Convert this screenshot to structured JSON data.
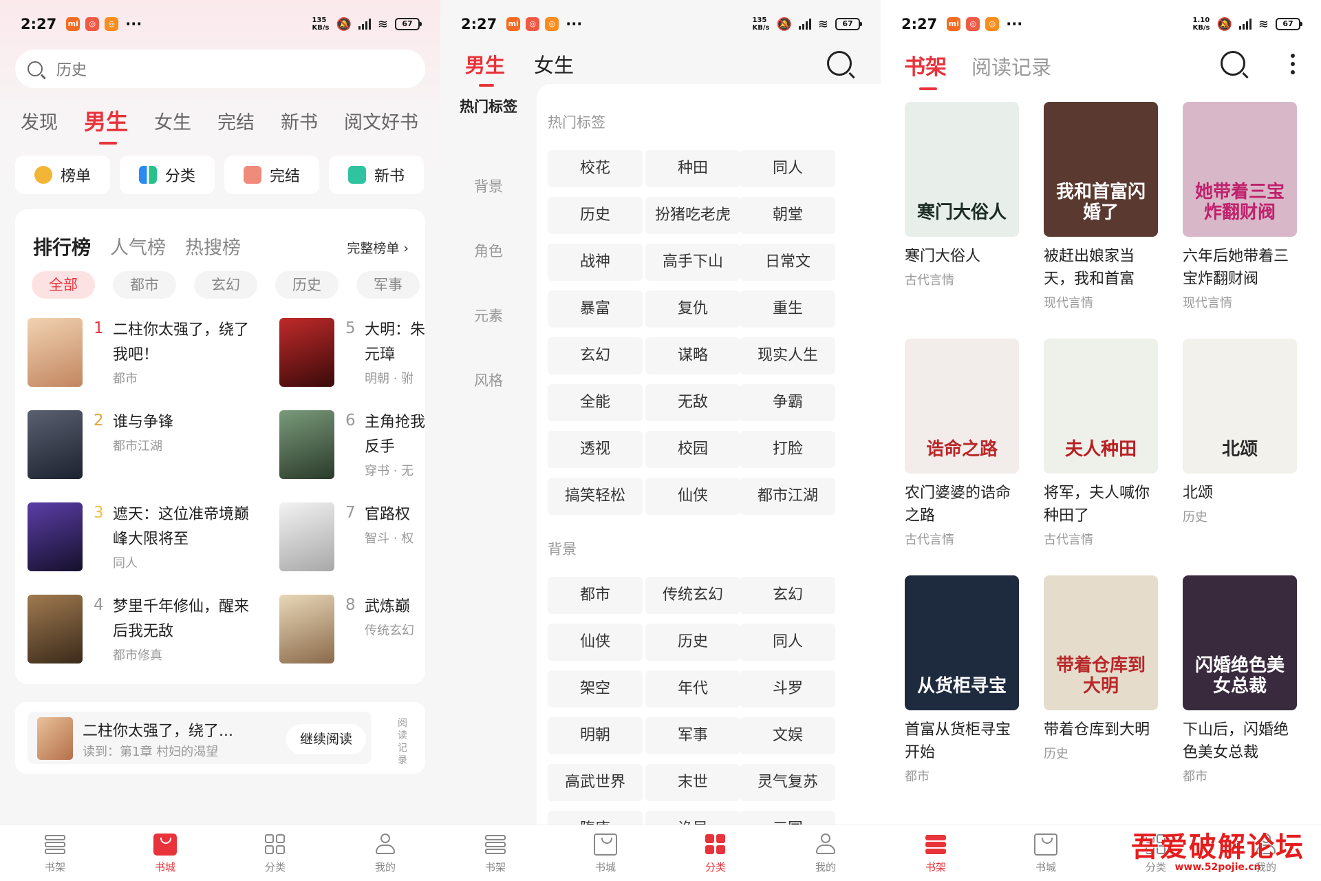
{
  "status_bars": [
    {
      "time": "2:27",
      "speed_top": "135",
      "speed_unit": "KB/s",
      "battery": "67"
    },
    {
      "time": "2:27",
      "speed_top": "135",
      "speed_unit": "KB/s",
      "battery": "67"
    },
    {
      "time": "2:27",
      "speed_top": "1.10",
      "speed_unit": "KB/s",
      "battery": "67"
    }
  ],
  "store": {
    "search_placeholder": "历史",
    "tabs": [
      "发现",
      "男生",
      "女生",
      "完结",
      "新书",
      "阅文好书"
    ],
    "active_tab": "男生",
    "quick": [
      {
        "label": "榜单",
        "color": "#f3b536"
      },
      {
        "label": "分类",
        "color": "#2c8af6"
      },
      {
        "label": "完结",
        "color": "#f08a7a"
      },
      {
        "label": "新书",
        "color": "#2fc3a0"
      }
    ],
    "rank_tabs": [
      "排行榜",
      "人气榜",
      "热搜榜"
    ],
    "full_rank": "完整榜单",
    "chips": [
      "全部",
      "都市",
      "玄幻",
      "历史",
      "军事"
    ],
    "ranks": [
      {
        "num": "1",
        "title": "二柱你太强了，绕了我吧！",
        "tag": "都市",
        "color": "#d7a57d"
      },
      {
        "num": "2",
        "title": "谁与争锋",
        "tag": "都市江湖",
        "color": "#3a4150"
      },
      {
        "num": "3",
        "title": "遮天：这位准帝境巅峰大限将至",
        "tag": "同人",
        "color": "#3b2a6b"
      },
      {
        "num": "4",
        "title": "梦里千年修仙，醒来后我无敌",
        "tag": "都市修真",
        "color": "#7a5a3a"
      },
      {
        "num": "5",
        "title": "大明：朱元璋",
        "tag": "明朝 · 驸",
        "color": "#8f1a1a"
      },
      {
        "num": "6",
        "title": "主角抢我反手",
        "tag": "穿书 · 无",
        "color": "#4a6a4a"
      },
      {
        "num": "7",
        "title": "官路权",
        "tag": "智斗 · 权",
        "color": "#cfcfcf"
      },
      {
        "num": "8",
        "title": "武炼巅",
        "tag": "传统玄幻",
        "color": "#c9b18a"
      }
    ],
    "continue": {
      "title": "二柱你太强了，绕了...",
      "progress": "读到：第1章 村妇的渴望",
      "button": "继续阅读",
      "history": "阅读记录"
    }
  },
  "category": {
    "top_tabs": [
      "男生",
      "女生"
    ],
    "side": [
      "热门标签",
      "背景",
      "角色",
      "元素",
      "风格"
    ],
    "sections": [
      {
        "title": "热门标签",
        "tags": [
          "校花",
          "种田",
          "同人",
          "历史",
          "扮猪吃老虎",
          "朝堂",
          "战神",
          "高手下山",
          "日常文",
          "暴富",
          "复仇",
          "重生",
          "玄幻",
          "谋略",
          "现实人生",
          "全能",
          "无敌",
          "争霸",
          "透视",
          "校园",
          "打脸",
          "搞笑轻松",
          "仙侠",
          "都市江湖"
        ]
      },
      {
        "title": "背景",
        "tags": [
          "都市",
          "传统玄幻",
          "玄幻",
          "仙侠",
          "历史",
          "同人",
          "架空",
          "年代",
          "斗罗",
          "明朝",
          "军事",
          "文娱",
          "高武世界",
          "末世",
          "灵气复苏",
          "隋唐",
          "诡异",
          "三国"
        ]
      }
    ]
  },
  "shelf": {
    "tabs": [
      "书架",
      "阅读记录"
    ],
    "books": [
      {
        "title": "寒门大俗人",
        "cat": "古代言情",
        "cover_text": "寒门大俗人",
        "bg": "#e8eeea",
        "fg": "#1d2b25"
      },
      {
        "title": "被赶出娘家当天，我和首富",
        "cat": "现代言情",
        "cover_text": "我和首富闪婚了",
        "bg": "#5a3a30",
        "fg": "#ffffff"
      },
      {
        "title": "六年后她带着三宝炸翻财阀",
        "cat": "现代言情",
        "cover_text": "她带着三宝炸翻财阀",
        "bg": "#d8b8c8",
        "fg": "#c0206c"
      },
      {
        "title": "农门婆婆的诰命之路",
        "cat": "古代言情",
        "cover_text": "诰命之路",
        "bg": "#f2ecea",
        "fg": "#b8282a"
      },
      {
        "title": "将军，夫人喊你种田了",
        "cat": "古代言情",
        "cover_text": "夫人种田",
        "bg": "#eef1ea",
        "fg": "#b81e22"
      },
      {
        "title": "北颂",
        "cat": "历史",
        "cover_text": "北颂",
        "bg": "#f3f1ec",
        "fg": "#2a2a2a"
      },
      {
        "title": "首富从货柜寻宝开始",
        "cat": "都市",
        "cover_text": "从货柜寻宝",
        "bg": "#1e2a3e",
        "fg": "#ffffff"
      },
      {
        "title": "带着仓库到大明",
        "cat": "历史",
        "cover_text": "带着仓库到大明",
        "bg": "#e6dccb",
        "fg": "#b8282a"
      },
      {
        "title": "下山后，闪婚绝色美女总裁",
        "cat": "都市",
        "cover_text": "闪婚绝色美女总裁",
        "bg": "#3a2a3e",
        "fg": "#ffffff"
      }
    ]
  },
  "bottom_navs": [
    {
      "items": [
        "书架",
        "书城",
        "分类",
        "我的"
      ],
      "active": "书城"
    },
    {
      "items": [
        "书架",
        "书城",
        "分类",
        "我的"
      ],
      "active": "分类"
    },
    {
      "items": [
        "书架",
        "书城",
        "分类",
        "我的"
      ],
      "active": "书架"
    }
  ],
  "watermark": {
    "line1": "吾爱破解论坛",
    "line2": "www.52pojie.cn"
  }
}
